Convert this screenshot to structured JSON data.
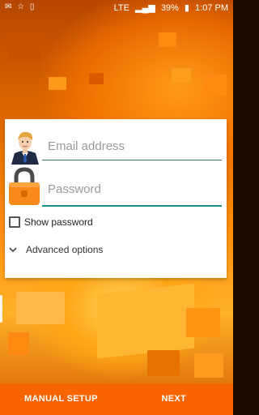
{
  "status_bar": {
    "notifications": "✉ ☆ ▯",
    "network": "LTE",
    "battery": "39%",
    "time": "1:07 PM"
  },
  "form": {
    "email_placeholder": "Email address",
    "password_placeholder": "Password",
    "show_password_label": "Show password",
    "advanced_label": "Advanced options"
  },
  "footer": {
    "manual_setup_label": "MANUAL SETUP",
    "next_label": "NEXT"
  },
  "colors": {
    "accent": "#f86400",
    "underline_active": "#1a8f87"
  },
  "icons": {
    "email": "user-avatar-icon",
    "password": "padlock-icon",
    "checkbox": "checkbox-unchecked-icon",
    "advanced": "chevron-down-icon"
  }
}
